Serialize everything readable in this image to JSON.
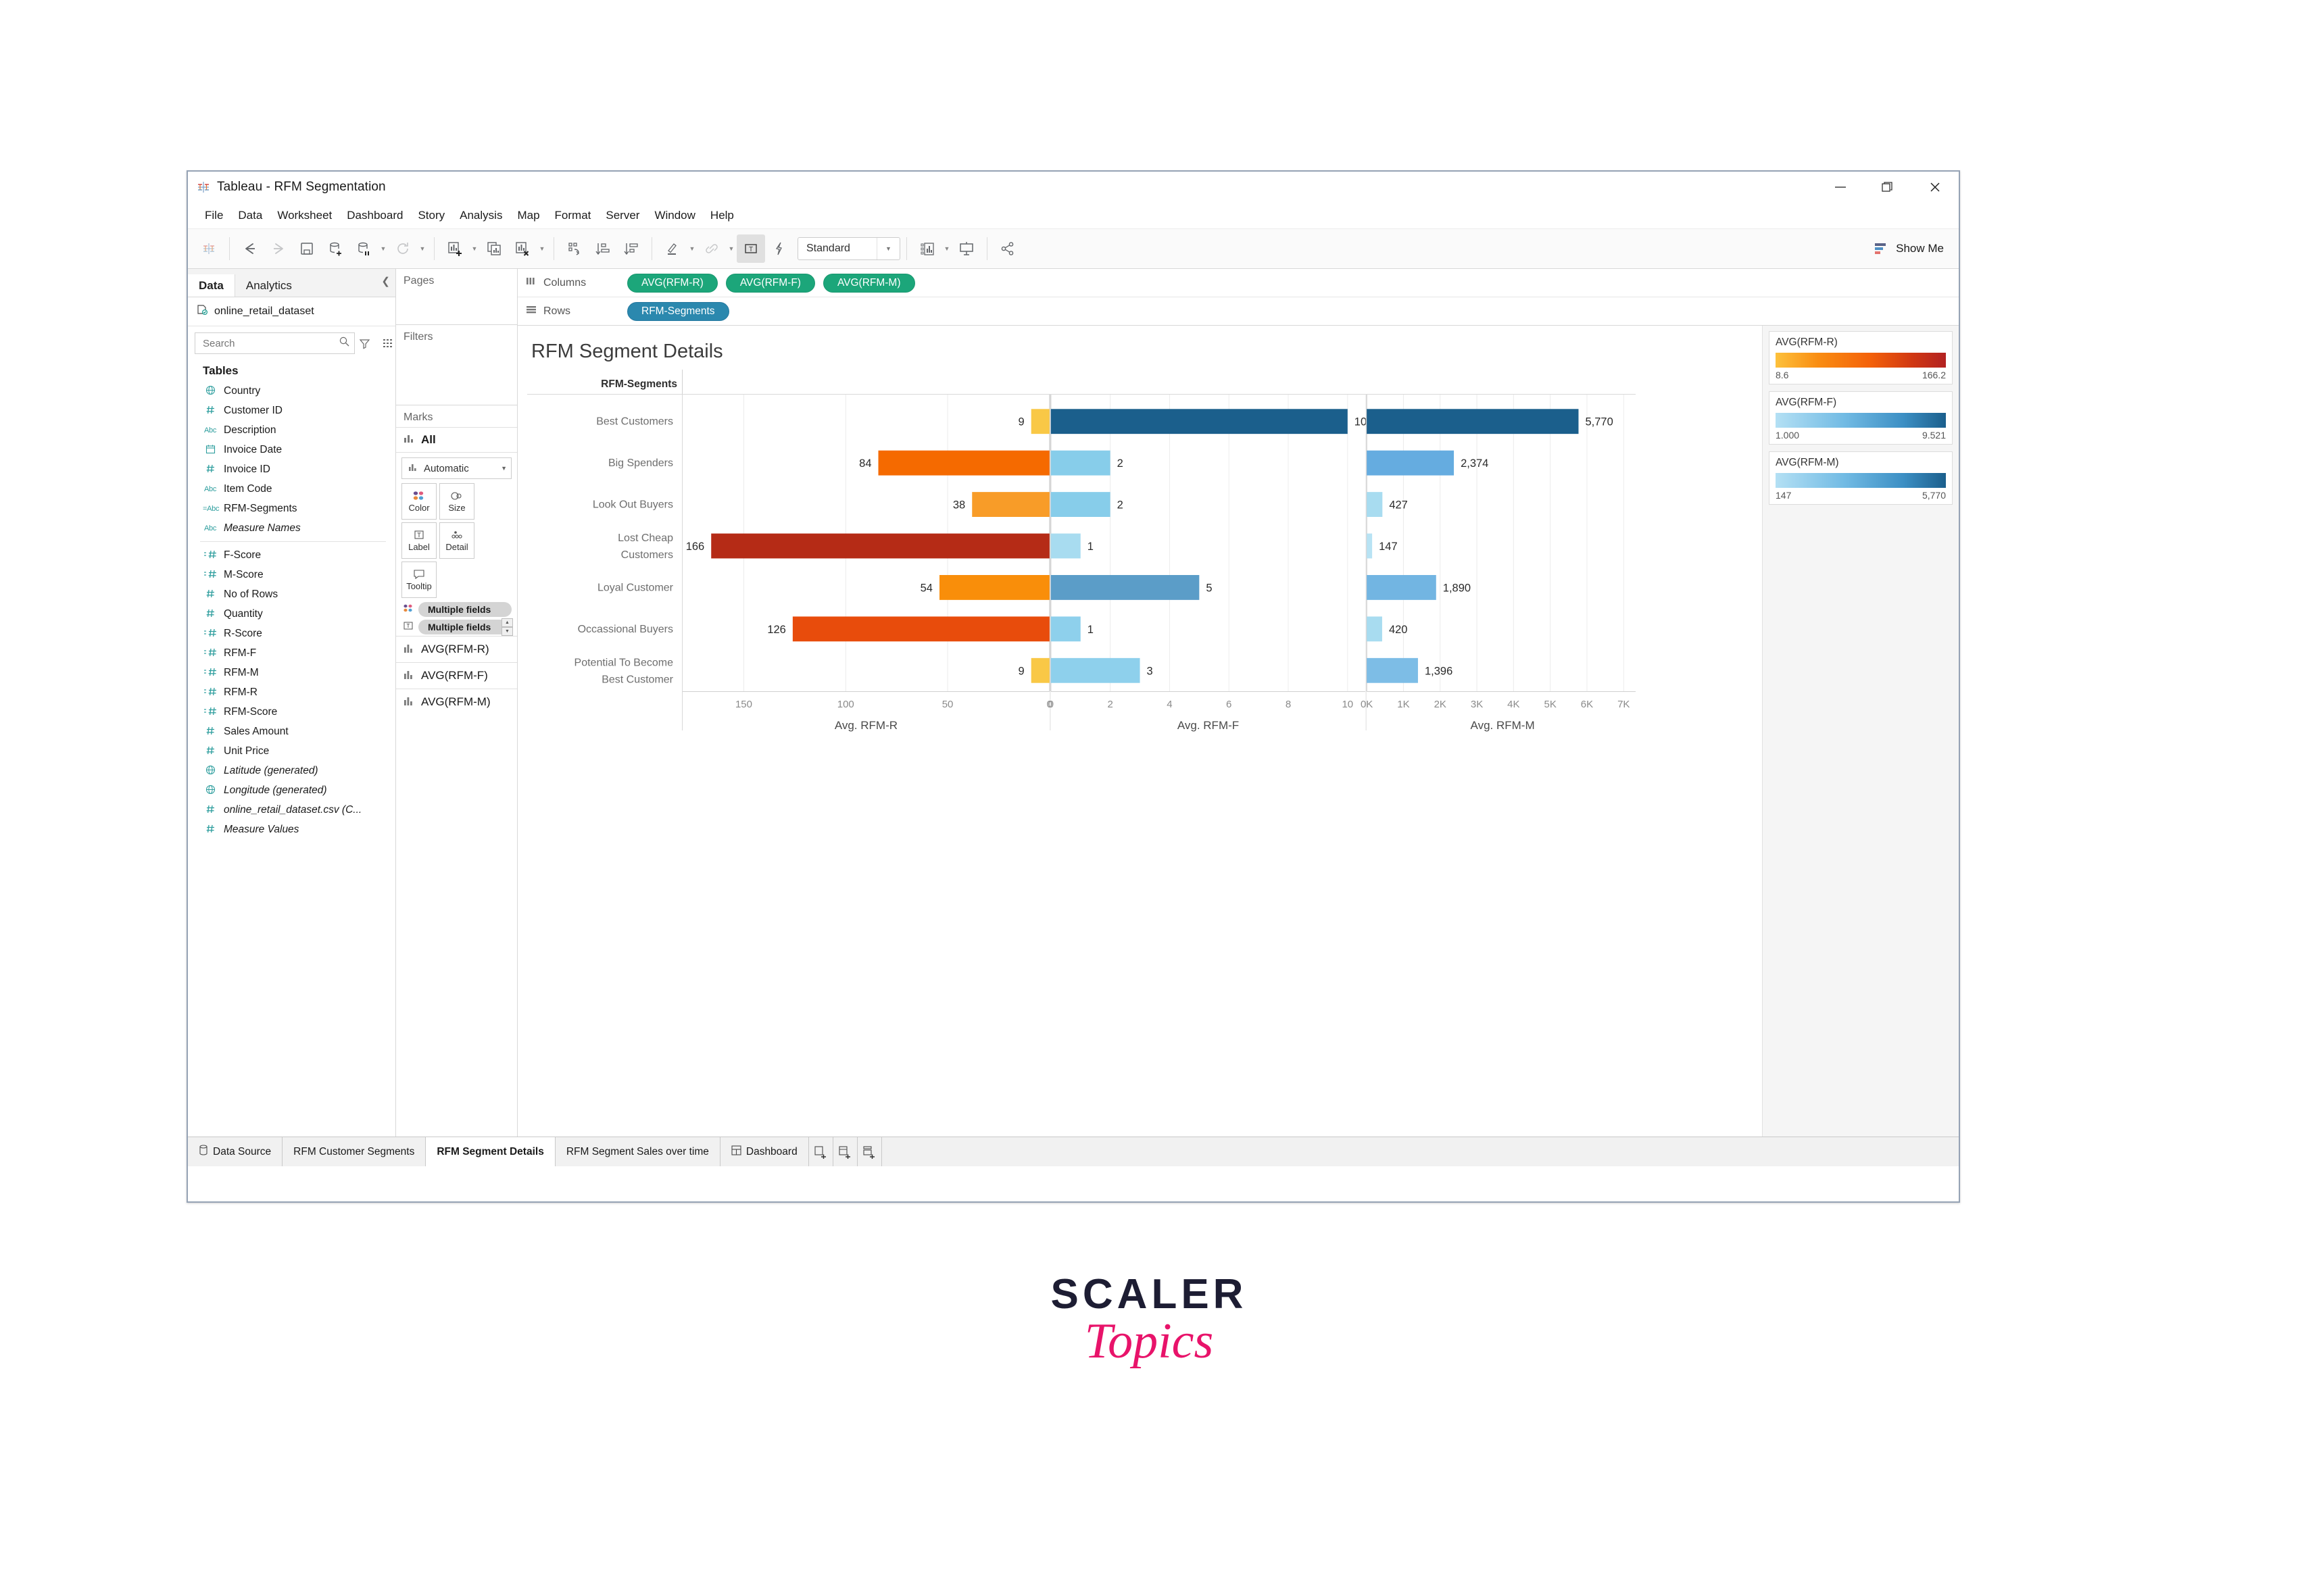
{
  "window": {
    "title": "Tableau - RFM Segmentation",
    "app_icon": "tableau-icon",
    "minimize": "—",
    "restore": "❐",
    "close": "✕"
  },
  "menu": [
    "File",
    "Data",
    "Worksheet",
    "Dashboard",
    "Story",
    "Analysis",
    "Map",
    "Format",
    "Server",
    "Window",
    "Help"
  ],
  "toolbar": {
    "fit_value": "Standard",
    "show_me_label": "Show Me",
    "buttons": [
      "tableau-logo-icon",
      "back-icon",
      "forward-icon",
      "save-icon",
      "new-data-source-icon",
      "pause-updates-icon",
      "refresh-icon",
      "new-worksheet-icon",
      "duplicate-sheet-icon",
      "clear-sheet-icon",
      "swap-rows-columns-icon",
      "sort-ascending-icon",
      "sort-descending-icon",
      "highlighter-icon",
      "group-icon",
      "show-mark-labels-icon",
      "fix-axes-icon",
      "presentation-mode-icon",
      "share-icon"
    ]
  },
  "data_pane": {
    "tabs": [
      {
        "label": "Data",
        "selected": true
      },
      {
        "label": "Analytics",
        "selected": false
      }
    ],
    "collapse_icon": "chevron-left-icon",
    "data_source": "online_retail_dataset",
    "search_placeholder": "Search",
    "section_header": "Tables",
    "fields": [
      {
        "label": "Country",
        "icon": "globe",
        "italic": false
      },
      {
        "label": "Customer ID",
        "icon": "hash",
        "italic": false
      },
      {
        "label": "Description",
        "icon": "abc",
        "italic": false
      },
      {
        "label": "Invoice Date",
        "icon": "calendar",
        "italic": false
      },
      {
        "label": "Invoice ID",
        "icon": "hash",
        "italic": false
      },
      {
        "label": "Item Code",
        "icon": "abc",
        "italic": false
      },
      {
        "label": "RFM-Segments",
        "icon": "abc-calc",
        "italic": false
      },
      {
        "label": "Measure Names",
        "icon": "abc",
        "italic": true
      }
    ],
    "measures": [
      {
        "label": "F-Score",
        "icon": "hash-calc",
        "italic": false
      },
      {
        "label": "M-Score",
        "icon": "hash-calc",
        "italic": false
      },
      {
        "label": "No of Rows",
        "icon": "hash",
        "italic": false
      },
      {
        "label": "Quantity",
        "icon": "hash",
        "italic": false
      },
      {
        "label": "R-Score",
        "icon": "hash-calc",
        "italic": false
      },
      {
        "label": "RFM-F",
        "icon": "hash-calc",
        "italic": false
      },
      {
        "label": "RFM-M",
        "icon": "hash-calc",
        "italic": false
      },
      {
        "label": "RFM-R",
        "icon": "hash-calc",
        "italic": false
      },
      {
        "label": "RFM-Score",
        "icon": "hash-calc",
        "italic": false
      },
      {
        "label": "Sales Amount",
        "icon": "hash",
        "italic": false
      },
      {
        "label": "Unit Price",
        "icon": "hash",
        "italic": false
      },
      {
        "label": "Latitude (generated)",
        "icon": "globe",
        "italic": true
      },
      {
        "label": "Longitude (generated)",
        "icon": "globe",
        "italic": true
      },
      {
        "label": "online_retail_dataset.csv (C...",
        "icon": "hash",
        "italic": true
      },
      {
        "label": "Measure Values",
        "icon": "hash",
        "italic": true
      }
    ]
  },
  "cards": {
    "pages_label": "Pages",
    "filters_label": "Filters",
    "marks_label": "Marks",
    "marks_all": "All",
    "mark_type": "Automatic",
    "buttons": [
      {
        "label": "Color",
        "icon": "color-icon"
      },
      {
        "label": "Size",
        "icon": "size-icon"
      },
      {
        "label": "Label",
        "icon": "label-icon"
      },
      {
        "label": "Detail",
        "icon": "detail-icon"
      },
      {
        "label": "Tooltip",
        "icon": "tooltip-icon"
      }
    ],
    "color_pill": "Multiple fields",
    "label_pill": "Multiple fields",
    "measure_cards": [
      "AVG(RFM-R)",
      "AVG(RFM-F)",
      "AVG(RFM-M)"
    ]
  },
  "shelves": {
    "columns_label": "Columns",
    "rows_label": "Rows",
    "columns": [
      "AVG(RFM-R)",
      "AVG(RFM-F)",
      "AVG(RFM-M)"
    ],
    "rows": [
      "RFM-Segments"
    ]
  },
  "legend": [
    {
      "title": "AVG(RFM-R)",
      "min": "8.6",
      "max": "166.2",
      "from": "#fdc13c",
      "to": "#b22222",
      "type": "orange-red"
    },
    {
      "title": "AVG(RFM-F)",
      "min": "1.000",
      "max": "9.521",
      "from": "#9ed4ee",
      "to": "#1b5f8c",
      "type": "blue"
    },
    {
      "title": "AVG(RFM-M)",
      "min": "147",
      "max": "5,770",
      "from": "#9ed4ee",
      "to": "#1b5f8c",
      "type": "blue"
    }
  ],
  "chart_data": {
    "type": "bar",
    "title": "RFM Segment Details",
    "row_header": "RFM-Segments",
    "categories": [
      "Best Customers",
      "Big Spenders",
      "Look Out Buyers",
      "Lost Cheap Customers",
      "Loyal Customer",
      "Occassional Buyers",
      "Potential To Become Best Customer"
    ],
    "panes": [
      {
        "field": "AVG(RFM-R)",
        "xlabel": "Avg. RFM-R",
        "ticks": [
          "150",
          "100",
          "50",
          "0"
        ],
        "tick_values": [
          150,
          100,
          50,
          0
        ],
        "axis_reversed": true,
        "xlim": [
          0,
          180
        ],
        "values": [
          9,
          84,
          38,
          166,
          54,
          126,
          9
        ],
        "labels": [
          "9",
          "84",
          "38",
          "166",
          "54",
          "126",
          "9"
        ],
        "colors": [
          "#f9c846",
          "#f56a00",
          "#f89c28",
          "#b52b16",
          "#f98e0a",
          "#e84c0c",
          "#f9c846"
        ]
      },
      {
        "field": "AVG(RFM-F)",
        "xlabel": "Avg. RFM-F",
        "ticks": [
          "0",
          "2",
          "4",
          "6",
          "8",
          "10"
        ],
        "tick_values": [
          0,
          2,
          4,
          6,
          8,
          10
        ],
        "axis_reversed": false,
        "xlim": [
          0,
          10.6
        ],
        "values": [
          10,
          2,
          2,
          1,
          5,
          1,
          3
        ],
        "labels": [
          "10",
          "2",
          "2",
          "1",
          "5",
          "1",
          "3"
        ],
        "colors": [
          "#1b5f8c",
          "#87cdea",
          "#87cdea",
          "#a8dcf0",
          "#5b9dc8",
          "#8ed0ec",
          "#8ed0ec"
        ]
      },
      {
        "field": "AVG(RFM-M)",
        "xlabel": "Avg. RFM-M",
        "ticks": [
          "0K",
          "1K",
          "2K",
          "3K",
          "4K",
          "5K",
          "6K",
          "7K"
        ],
        "tick_values": [
          0,
          1000,
          2000,
          3000,
          4000,
          5000,
          6000,
          7000
        ],
        "axis_reversed": false,
        "xlim": [
          0,
          7400
        ],
        "values": [
          5770,
          2374,
          427,
          147,
          1890,
          420,
          1396
        ],
        "labels": [
          "5,770",
          "2,374",
          "427",
          "147",
          "1,890",
          "420",
          "1,396"
        ],
        "colors": [
          "#1b5f8c",
          "#65ace0",
          "#a8dcf0",
          "#b8e3f4",
          "#72b5e2",
          "#a8dcf0",
          "#7dbde6"
        ]
      }
    ],
    "grid": true,
    "legend_position": "right"
  },
  "bottom_tabs": {
    "items": [
      {
        "label": "Data Source",
        "icon": "data-source-icon",
        "selected": false
      },
      {
        "label": "RFM Customer Segments",
        "icon": "",
        "selected": false
      },
      {
        "label": "RFM Segment Details",
        "icon": "",
        "selected": true
      },
      {
        "label": "RFM Segment Sales over time",
        "icon": "",
        "selected": false
      },
      {
        "label": "Dashboard",
        "icon": "dashboard-icon",
        "selected": false
      }
    ],
    "new_buttons": [
      "new-worksheet-icon",
      "new-dashboard-icon",
      "new-story-icon"
    ]
  },
  "branding": {
    "scaler": "SCALER",
    "topics": "Topics"
  }
}
